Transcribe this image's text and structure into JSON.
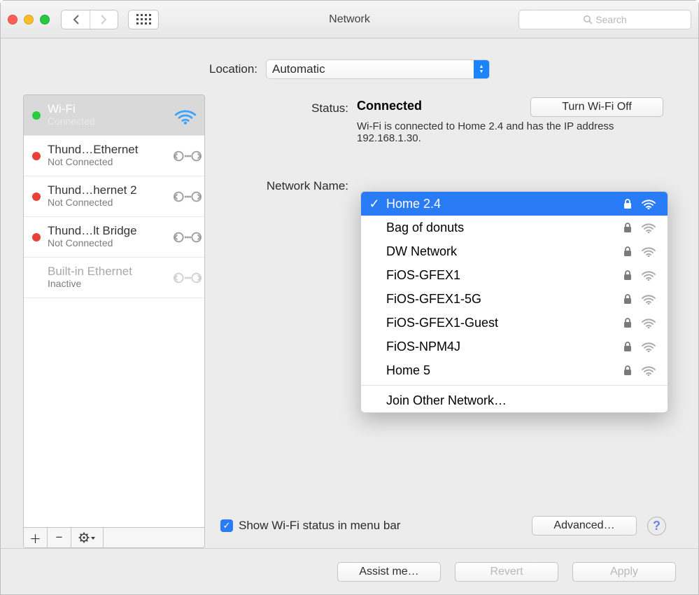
{
  "window": {
    "title": "Network"
  },
  "search": {
    "placeholder": "Search"
  },
  "location": {
    "label": "Location:",
    "value": "Automatic"
  },
  "services": [
    {
      "title": "Wi-Fi",
      "status": "Connected",
      "dot": "green",
      "icon": "wifi",
      "selected": true
    },
    {
      "title": "Thund…Ethernet",
      "status": "Not Connected",
      "dot": "red",
      "icon": "ether"
    },
    {
      "title": "Thund…hernet 2",
      "status": "Not Connected",
      "dot": "red",
      "icon": "ether"
    },
    {
      "title": "Thund…lt Bridge",
      "status": "Not Connected",
      "dot": "red",
      "icon": "ether"
    },
    {
      "title": "Built-in Ethernet",
      "status": "Inactive",
      "dot": "none",
      "icon": "ether-dim"
    }
  ],
  "status": {
    "label": "Status:",
    "value": "Connected",
    "desc": "Wi-Fi is connected to Home 2.4 and has the IP address 192.168.1.30.",
    "turn_off": "Turn Wi-Fi Off"
  },
  "network_name": {
    "label": "Network Name:"
  },
  "wifi_networks": [
    {
      "name": "Home 2.4",
      "locked": true,
      "selected": true
    },
    {
      "name": "Bag of donuts",
      "locked": true
    },
    {
      "name": "DW Network",
      "locked": true
    },
    {
      "name": "FiOS-GFEX1",
      "locked": true
    },
    {
      "name": "FiOS-GFEX1-5G",
      "locked": true
    },
    {
      "name": "FiOS-GFEX1-Guest",
      "locked": true
    },
    {
      "name": "FiOS-NPM4J",
      "locked": true
    },
    {
      "name": "Home 5",
      "locked": true
    }
  ],
  "wifi_dropdown": {
    "join_other": "Join Other Network…"
  },
  "show_menu_bar": {
    "label": "Show Wi-Fi status in menu bar",
    "checked": true
  },
  "advanced_button": "Advanced…",
  "help": "?",
  "footer": {
    "assist": "Assist me…",
    "revert": "Revert",
    "apply": "Apply"
  }
}
